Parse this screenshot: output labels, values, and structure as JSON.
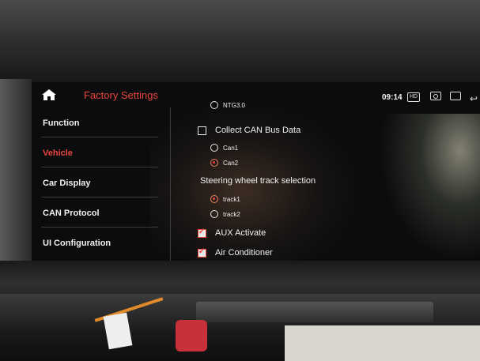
{
  "header": {
    "title": "Factory Settings",
    "time": "09:14",
    "hd_badge": "HD"
  },
  "sidebar": {
    "items": [
      {
        "label": "Function",
        "active": false
      },
      {
        "label": "Vehicle",
        "active": true
      },
      {
        "label": "Car Display",
        "active": false
      },
      {
        "label": "CAN Protocol",
        "active": false
      },
      {
        "label": "UI Configuration",
        "active": false
      }
    ]
  },
  "content": {
    "partial_option": {
      "label": "NTG3.0",
      "selected": false
    },
    "collect_can": {
      "label": "Collect CAN Bus Data",
      "checked": false
    },
    "can_options": [
      {
        "label": "Can1",
        "selected": false
      },
      {
        "label": "Can2",
        "selected": true
      }
    ],
    "steering_heading": "Steering wheel track selection",
    "track_options": [
      {
        "label": "track1",
        "selected": true
      },
      {
        "label": "track2",
        "selected": false
      }
    ],
    "aux": {
      "label": "AUX Activate",
      "checked": true
    },
    "air_conditioner": {
      "label": "Air Conditioner",
      "checked": true
    }
  },
  "colors": {
    "accent": "#e8453c",
    "text": "#f0f0f0",
    "screen_bg": "#0b0c0e"
  },
  "icons": [
    "home-icon",
    "camera-icon",
    "window-icon",
    "back-icon"
  ]
}
